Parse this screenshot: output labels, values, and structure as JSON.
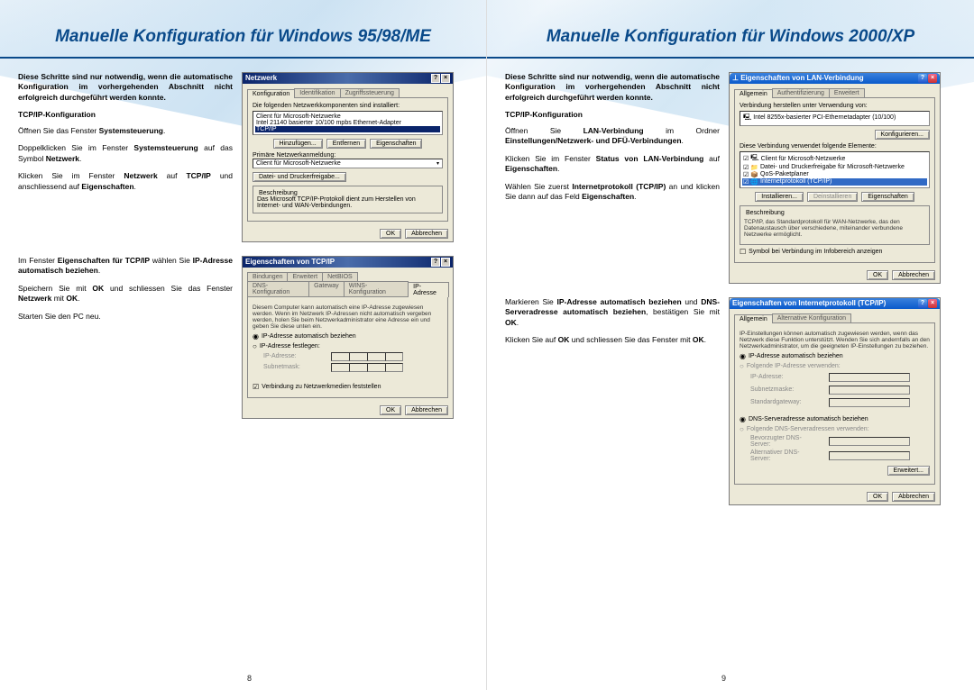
{
  "left": {
    "title": "Manuelle Konfiguration für Windows 95/98/ME",
    "intro": "Diese Schritte sind nur notwendig, wenn die automatische Konfiguration im vorhergehenden Abschnitt nicht erfolgreich durchgeführt werden konnte.",
    "subhead1": "TCP/IP-Konfiguration",
    "steps_top": [
      "Öffnen Sie das Fenster <b>Systemsteuerung</b>.",
      "Doppelklicken Sie im Fenster <b>Systemsteuerung</b> auf das Symbol <b>Netzwerk</b>.",
      "Klicken Sie im Fenster <b>Netzwerk</b> auf <b>TCP/IP</b> und anschliessend auf <b>Eigenschaften</b>."
    ],
    "steps_bottom": [
      "Im Fenster <b>Eigenschaften für TCP/IP</b> wählen Sie <b>IP-Adresse automatisch beziehen</b>.",
      "Speichern Sie mit <b>OK</b> und schliessen Sie das Fenster <b>Netzwerk</b> mit <b>OK</b>.",
      "Starten Sie den PC neu."
    ],
    "dlg1": {
      "title": "Netzwerk",
      "tabs": [
        "Konfiguration",
        "Identifikation",
        "Zugriffssteuerung"
      ],
      "label_components": "Die folgenden Netzwerkkomponenten sind installiert:",
      "items": [
        "Client für Microsoft-Netzwerke",
        "Intel 21140 basierter 10/100 mpbs Ethernet-Adapter",
        "TCP/IP"
      ],
      "btn_add": "Hinzufügen...",
      "btn_remove": "Entfernen",
      "btn_props": "Eigenschaften",
      "label_logon": "Primäre Netzwerkanmeldung:",
      "logon_value": "Client für Microsoft-Netzwerke",
      "btn_share": "Datei- und Druckerfreigabe...",
      "legend_desc": "Beschreibung",
      "desc": "Das Microsoft TCP/IP-Protokoll dient zum Herstellen von Internet- und WAN-Verbindungen.",
      "ok": "OK",
      "cancel": "Abbrechen"
    },
    "dlg2": {
      "title": "Eigenschaften von TCP/IP",
      "tabs_row1": [
        "Bindungen",
        "Erweitert",
        "NetBIOS"
      ],
      "tabs_row2": [
        "DNS-Konfiguration",
        "Gateway",
        "WINS-Konfiguration",
        "IP-Adresse"
      ],
      "desc": "Diesem Computer kann automatisch eine IP-Adresse zugewiesen werden. Wenn im Netzwerk IP-Adressen nicht automatisch vergeben werden, holen Sie beim Netzwerkadministrator eine Adresse ein und geben Sie diese unten ein.",
      "radio_auto": "IP-Adresse automatisch beziehen",
      "radio_manual": "IP-Adresse festlegen:",
      "lbl_ip": "IP-Adresse:",
      "lbl_subnet": "Subnetmask:",
      "chk_detect": "Verbindung zu Netzwerkmedien feststellen",
      "ok": "OK",
      "cancel": "Abbrechen"
    },
    "page_num": "8"
  },
  "right": {
    "title": "Manuelle Konfiguration für Windows 2000/XP",
    "intro": "Diese Schritte sind nur notwendig, wenn die automatische Konfiguration im vorhergehenden Abschnitt nicht erfolgreich durchgeführt werden konnte.",
    "subhead1": "TCP/IP-Konfiguration",
    "steps_top": [
      "Öffnen Sie <b>LAN-Verbindung</b> im Ordner <b>Einstellungen/Netzwerk- und DFÜ-Verbindungen</b>.",
      "Klicken Sie im Fenster <b>Status von LAN-Verbindung</b> auf <b>Eigenschaften</b>.",
      "Wählen Sie zuerst <b>Internetprotokoll (TCP/IP)</b> an und klicken Sie dann auf das Feld <b>Eigenschaften</b>."
    ],
    "steps_bottom": [
      "Markieren Sie <b>IP-Adresse automatisch beziehen</b> und <b>DNS-Serveradresse automatisch beziehen</b>, bestätigen Sie mit <b>OK</b>.",
      "Klicken Sie auf <b>OK</b> und schliessen Sie das Fenster mit <b>OK</b>."
    ],
    "dlg1": {
      "title": "Eigenschaften von LAN-Verbindung",
      "tabs": [
        "Allgemein",
        "Authentifizierung",
        "Erweitert"
      ],
      "lbl_connect": "Verbindung herstellen unter Verwendung von:",
      "adapter": "Intel 8255x-basierter PCI-Ethernetadapter (10/100)",
      "btn_configure": "Konfigurieren...",
      "lbl_uses": "Diese Verbindung verwendet folgende Elemente:",
      "items": [
        "Client für Microsoft-Netzwerke",
        "Datei- und Druckerfreigabe für Microsoft-Netzwerke",
        "QoS-Paketplaner",
        "Internetprotokoll (TCP/IP)"
      ],
      "btn_install": "Installieren...",
      "btn_uninstall": "Deinstallieren",
      "btn_props": "Eigenschaften",
      "legend_desc": "Beschreibung",
      "desc": "TCP/IP, das Standardprotokoll für WAN-Netzwerke, das den Datenaustausch über verschiedene, miteinander verbundene Netzwerke ermöglicht.",
      "chk_notify": "Symbol bei Verbindung im Infobereich anzeigen",
      "ok": "OK",
      "cancel": "Abbrechen"
    },
    "dlg2": {
      "title": "Eigenschaften von Internetprotokoll (TCP/IP)",
      "tabs": [
        "Allgemein",
        "Alternative Konfiguration"
      ],
      "desc": "IP-Einstellungen können automatisch zugewiesen werden, wenn das Netzwerk diese Funktion unterstützt. Wenden Sie sich andernfalls an den Netzwerkadministrator, um die geeigneten IP-Einstellungen zu beziehen.",
      "radio_auto_ip": "IP-Adresse automatisch beziehen",
      "radio_manual_ip": "Folgende IP-Adresse verwenden:",
      "lbl_ip": "IP-Adresse:",
      "lbl_subnet": "Subnetzmaske:",
      "lbl_gw": "Standardgateway:",
      "radio_auto_dns": "DNS-Serveradresse automatisch beziehen",
      "radio_manual_dns": "Folgende DNS-Serveradressen verwenden:",
      "lbl_dns1": "Bevorzugter DNS-Server:",
      "lbl_dns2": "Alternativer DNS-Server:",
      "btn_adv": "Erweitert...",
      "ok": "OK",
      "cancel": "Abbrechen"
    },
    "page_num": "9"
  }
}
